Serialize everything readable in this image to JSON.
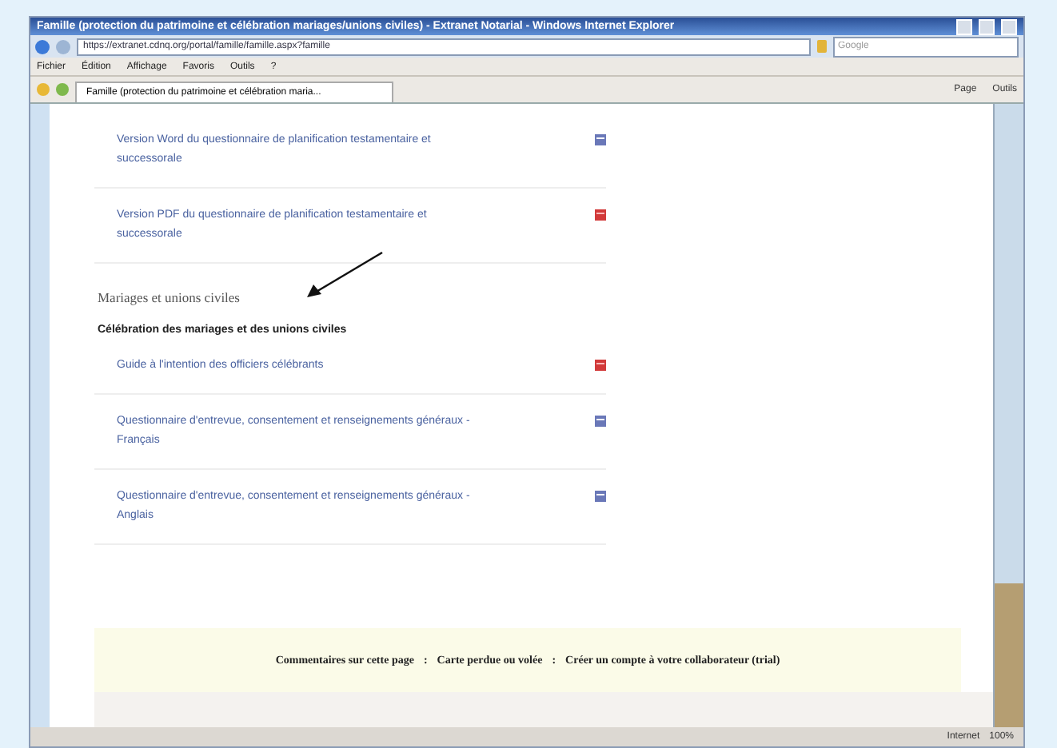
{
  "window": {
    "title": "Famille (protection du patrimoine et célébration mariages/unions civiles) - Extranet Notarial - Windows Internet Explorer"
  },
  "address_bar": {
    "url": "https://extranet.cdnq.org/portal/famille/famille.aspx?famille",
    "search_placeholder": "Google"
  },
  "menu": [
    "Fichier",
    "Édition",
    "Affichage",
    "Favoris",
    "Outils",
    "?"
  ],
  "tab": {
    "title": "Famille (protection du patrimoine et célébration maria..."
  },
  "command_bar": [
    "Page",
    "Outils"
  ],
  "sections": [
    {
      "kind": "list",
      "items": [
        {
          "text": "Version Word du questionnaire de planification testamentaire et successorale",
          "kind": "word"
        },
        {
          "text": "Version PDF du questionnaire de planification testamentaire et successorale",
          "kind": "pdf"
        }
      ]
    },
    {
      "kind": "heading",
      "text": "Mariages et unions civiles"
    },
    {
      "kind": "subheading",
      "text": "Célébration des mariages et des unions civiles"
    },
    {
      "kind": "list",
      "items": [
        {
          "text": "Guide à l'intention des officiers célébrants",
          "kind": "pdf"
        },
        {
          "text": "Questionnaire d'entrevue, consentement et renseignements généraux - Français",
          "kind": "word"
        },
        {
          "text": "Questionnaire d'entrevue, consentement et renseignements généraux - Anglais",
          "kind": "word"
        }
      ]
    }
  ],
  "footer": {
    "links": [
      "Commentaires sur cette page",
      "Carte perdue ou volée",
      "Créer un compte à votre collaborateur (trial)"
    ],
    "separators": [
      ":",
      ":"
    ]
  },
  "status_bar": {
    "zone": "Internet",
    "zoom": "100%"
  }
}
